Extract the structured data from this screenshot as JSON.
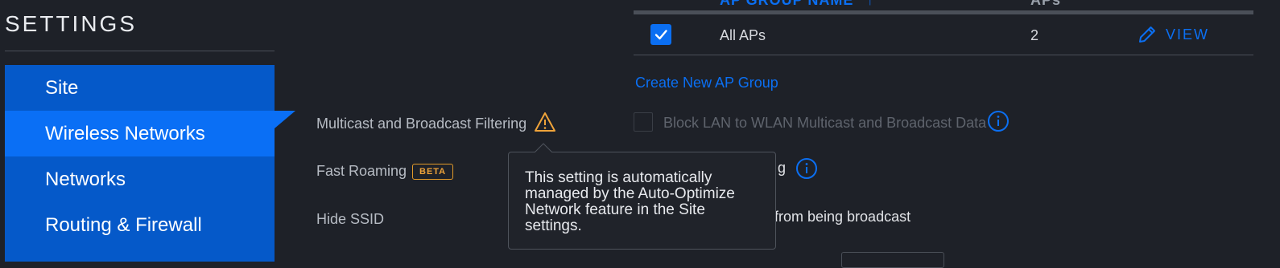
{
  "sidebar": {
    "title": "SETTINGS",
    "items": [
      {
        "label": "Site",
        "active": false
      },
      {
        "label": "Wireless Networks",
        "active": true
      },
      {
        "label": "Networks",
        "active": false
      },
      {
        "label": "Routing & Firewall",
        "active": false
      }
    ]
  },
  "form": {
    "multicast_label": "Multicast and Broadcast Filtering",
    "fast_roaming_label": "Fast Roaming",
    "beta_badge": "BETA",
    "hide_ssid_label": "Hide SSID"
  },
  "ap_groups": {
    "columns": [
      "AP GROUP NAME",
      "APs"
    ],
    "rows": [
      {
        "name": "All APs",
        "aps": "2",
        "checked": true,
        "action": "VIEW"
      }
    ],
    "create_link": "Create New AP Group"
  },
  "options": {
    "block_lan_label": "Block LAN to WLAN Multicast and Broadcast Data",
    "partial_label": "g",
    "partial_label_2": "from being broadcast"
  },
  "tooltip": {
    "text": "This setting is automatically managed by the Auto-Optimize Network feature in the Site settings."
  },
  "colors": {
    "accent": "#0b6ff2",
    "sidebar": "#0559c9",
    "sidebar_active": "#0a6ff5",
    "warning": "#f0a43a",
    "background": "#1e2128"
  },
  "icons": {
    "warning": "warning-triangle-icon",
    "check": "check-icon",
    "edit": "pencil-icon",
    "info": "info-circle-icon",
    "sort": "sort-arrow-icon"
  }
}
